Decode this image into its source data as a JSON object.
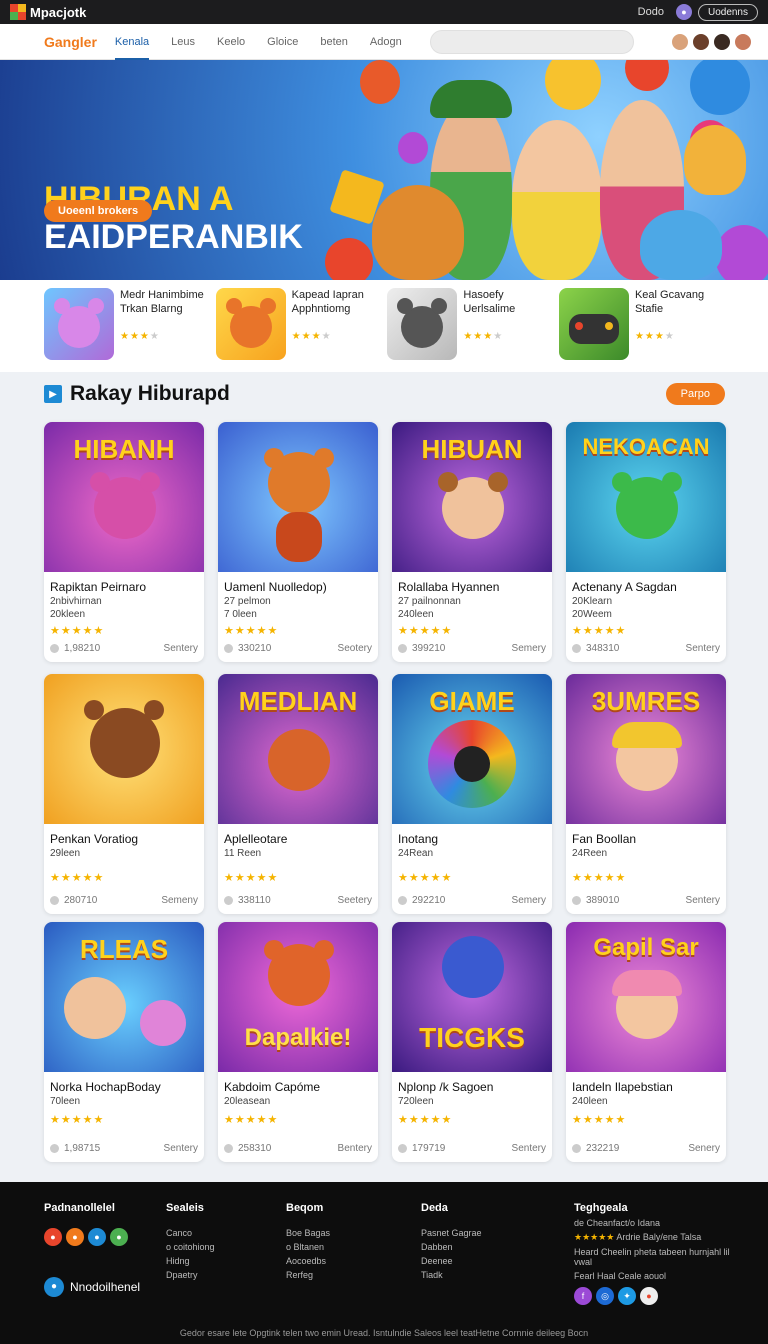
{
  "topbar": {
    "brand": "Mpacjotk",
    "link": "Dodo",
    "button": "Uodenns"
  },
  "nav": {
    "logo": "Gangler",
    "tabs": [
      {
        "label": "Kenala",
        "active": true
      },
      {
        "label": "Leus"
      },
      {
        "label": "Keelo"
      },
      {
        "label": "Gloice"
      },
      {
        "label": "beten"
      },
      {
        "label": "Adogn"
      }
    ],
    "search_placeholder": ""
  },
  "hero": {
    "title_line1": "HIBURAN A",
    "title_line2": "EAIDPERANBIK",
    "button": "Uoeenl brokers"
  },
  "featured": [
    {
      "title": "Medr Hanimbime Trkan Blarng",
      "stars": 3
    },
    {
      "title": "Kapead Iapran Apphntiomg",
      "stars": 3
    },
    {
      "title": "Hasoefy Uerlsalime",
      "stars": 3
    },
    {
      "title": "Keal Gcavang Stafie",
      "stars": 3
    }
  ],
  "section": {
    "title": "Rakay Hiburapd",
    "button": "Parpo"
  },
  "games": [
    {
      "thumb_text": "HIBANH",
      "title": "Rapiktan Peirnaro",
      "sub1": "2nbivhirnan",
      "sub2": "20kleen",
      "count": "1,98210",
      "foot": "Sentery",
      "stars": 5
    },
    {
      "thumb_text": "",
      "title": "Uamenl Nuolledop)",
      "sub1": "27 pelmon",
      "sub2": "7 0leen",
      "count": "330210",
      "foot": "Seotery",
      "stars": 5
    },
    {
      "thumb_text": "HIBUAN",
      "title": "Rolallaba Hyannen",
      "sub1": "27 pailnonnan",
      "sub2": "240leen",
      "count": "399210",
      "foot": "Semery",
      "stars": 5
    },
    {
      "thumb_text": "NEKOACAN",
      "title": "Actenany A Sagdan",
      "sub1": "20Klearn",
      "sub2": "20Weem",
      "count": "348310",
      "foot": "Sentery",
      "stars": 5
    },
    {
      "thumb_text": "",
      "title": "Penkan Voratiog",
      "sub1": "29leen",
      "sub2": "",
      "count": "280710",
      "foot": "Semeny",
      "stars": 5
    },
    {
      "thumb_text": "MEDLIAN",
      "title": "Aplelleotare",
      "sub1": "11 Reen",
      "sub2": "",
      "count": "338110",
      "foot": "Seetery",
      "stars": 5
    },
    {
      "thumb_text": "GIAME",
      "title": "Inotang",
      "sub1": "24Rean",
      "sub2": "",
      "count": "292210",
      "foot": "Semery",
      "stars": 5
    },
    {
      "thumb_text": "3UMRES",
      "title": "Fan Boollan",
      "sub1": "24Reen",
      "sub2": "",
      "count": "389010",
      "foot": "Sentery",
      "stars": 5
    },
    {
      "thumb_text": "RLEAS",
      "title": "Norka HochapBoday",
      "sub1": "70leen",
      "sub2": "",
      "count": "1,98715",
      "foot": "Sentery",
      "stars": 5
    },
    {
      "thumb_text": "Dapalkie!",
      "title": "Kabdoim Capóme",
      "sub1": "20leasean",
      "sub2": "",
      "count": "258310",
      "foot": "Bentery",
      "stars": 5
    },
    {
      "thumb_text": "TICGKS",
      "title": "Nplonp /k Sagoen",
      "sub1": "720leen",
      "sub2": "",
      "count": "179719",
      "foot": "Sentery",
      "stars": 5
    },
    {
      "thumb_text": "Gapil Sar",
      "title": "Iandeln Ilapebstian",
      "sub1": "240leen",
      "sub2": "",
      "count": "232219",
      "foot": "Senery",
      "stars": 5
    }
  ],
  "footer": {
    "brand_col_title": "Padnanollelel",
    "brand_name": "Nnodoilhenel",
    "columns": [
      {
        "title": "Sealeis",
        "items": [
          "Canco",
          "o coitohiong",
          "Hidng",
          "Dpaetry"
        ]
      },
      {
        "title": "Beqom",
        "items": [
          "Boe Bagas",
          "o Bltanen",
          "Aocoedbs",
          "Rerfeg"
        ]
      },
      {
        "title": "Deda",
        "items": [
          "Pasnet Gagrae",
          "Dabben",
          "Deenee",
          "Tiadk"
        ]
      }
    ],
    "contact_title": "Teghgeala",
    "contact_lines": [
      "de Cheanfact/o Idana",
      "Ardrie Baly/ene Talsa",
      "Heard Cheelin pheta tabeen hurnjahl lil vwal",
      "Fearl Haal Ceale aouol"
    ],
    "copyright": "Gedor esare lete Opgtink telen two emin Uread. Isntulndie Saleos leel teatHetne Cornnie deileeg Bocn"
  }
}
